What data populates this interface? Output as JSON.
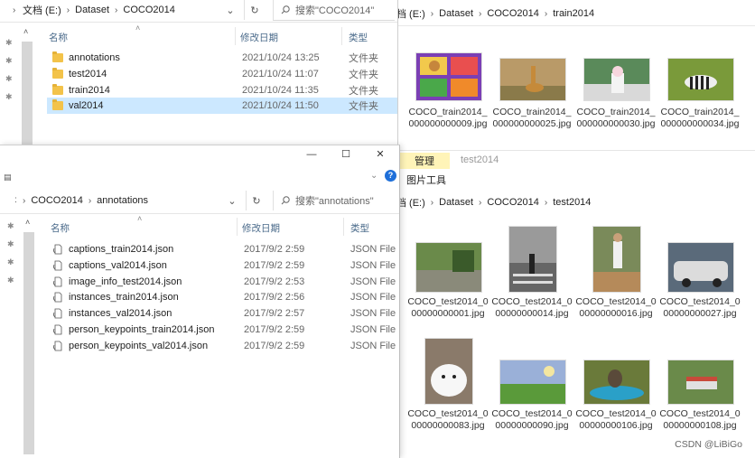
{
  "top_left": {
    "path": [
      "文档 (E:)",
      "Dataset",
      "COCO2014"
    ],
    "search_placeholder": "搜索\"COCO2014\"",
    "columns": {
      "name": "名称",
      "date": "修改日期",
      "type": "类型"
    },
    "rows": [
      {
        "name": "annotations",
        "date": "2021/10/24 13:25",
        "type": "文件夹"
      },
      {
        "name": "test2014",
        "date": "2021/10/24 11:07",
        "type": "文件夹"
      },
      {
        "name": "train2014",
        "date": "2021/10/24 11:35",
        "type": "文件夹"
      },
      {
        "name": "val2014",
        "date": "2021/10/24 11:50",
        "type": "文件夹"
      }
    ]
  },
  "bottom_left": {
    "window_controls": {
      "minimize": "—",
      "maximize": "☐",
      "close": "✕"
    },
    "path": [
      "COCO2014",
      "annotations"
    ],
    "search_placeholder": "搜索\"annotations\"",
    "columns": {
      "name": "名称",
      "date": "修改日期",
      "type": "类型"
    },
    "rows": [
      {
        "name": "captions_train2014.json",
        "date": "2017/9/2 2:59",
        "type": "JSON File"
      },
      {
        "name": "captions_val2014.json",
        "date": "2017/9/2 2:59",
        "type": "JSON File"
      },
      {
        "name": "image_info_test2014.json",
        "date": "2017/9/2 2:53",
        "type": "JSON File"
      },
      {
        "name": "instances_train2014.json",
        "date": "2017/9/2 2:56",
        "type": "JSON File"
      },
      {
        "name": "instances_val2014.json",
        "date": "2017/9/2 2:57",
        "type": "JSON File"
      },
      {
        "name": "person_keypoints_train2014.json",
        "date": "2017/9/2 2:59",
        "type": "JSON File"
      },
      {
        "name": "person_keypoints_val2014.json",
        "date": "2017/9/2 2:59",
        "type": "JSON File"
      }
    ]
  },
  "right_top": {
    "path": [
      "档 (E:)",
      "Dataset",
      "COCO2014",
      "train2014"
    ],
    "items": [
      {
        "caption": "COCO_train2014_000000000009.jpg",
        "icon": "image-lunchbox"
      },
      {
        "caption": "COCO_train2014_000000000025.jpg",
        "icon": "image-giraffe"
      },
      {
        "caption": "COCO_train2014_000000000030.jpg",
        "icon": "image-vase"
      },
      {
        "caption": "COCO_train2014_000000000034.jpg",
        "icon": "image-zebra"
      }
    ]
  },
  "right_bottom": {
    "ribbon": {
      "manage_tab": "管理",
      "folder_label": "test2014",
      "tools_label": "图片工具"
    },
    "path": [
      "档 (E:)",
      "Dataset",
      "COCO2014",
      "test2014"
    ],
    "items": [
      {
        "caption": "COCO_test2014_000000000001.jpg",
        "icon": "image-street"
      },
      {
        "caption": "COCO_test2014_000000000014.jpg",
        "icon": "image-crosswalk"
      },
      {
        "caption": "COCO_test2014_000000000016.jpg",
        "icon": "image-baseball"
      },
      {
        "caption": "COCO_test2014_000000000027.jpg",
        "icon": "image-car"
      },
      {
        "caption": "COCO_test2014_000000000083.jpg",
        "icon": "image-dog"
      },
      {
        "caption": "COCO_test2014_000000000090.jpg",
        "icon": "image-field"
      },
      {
        "caption": "COCO_test2014_000000000106.jpg",
        "icon": "image-bird"
      },
      {
        "caption": "COCO_test2014_000000000108.jpg",
        "icon": "image-train"
      }
    ]
  },
  "watermark": "CSDN @LiBiGo",
  "colors": {
    "selected_row": "#cce8ff",
    "ribbon_active": "#fff4b8",
    "help_blue": "#1e6fd9"
  }
}
